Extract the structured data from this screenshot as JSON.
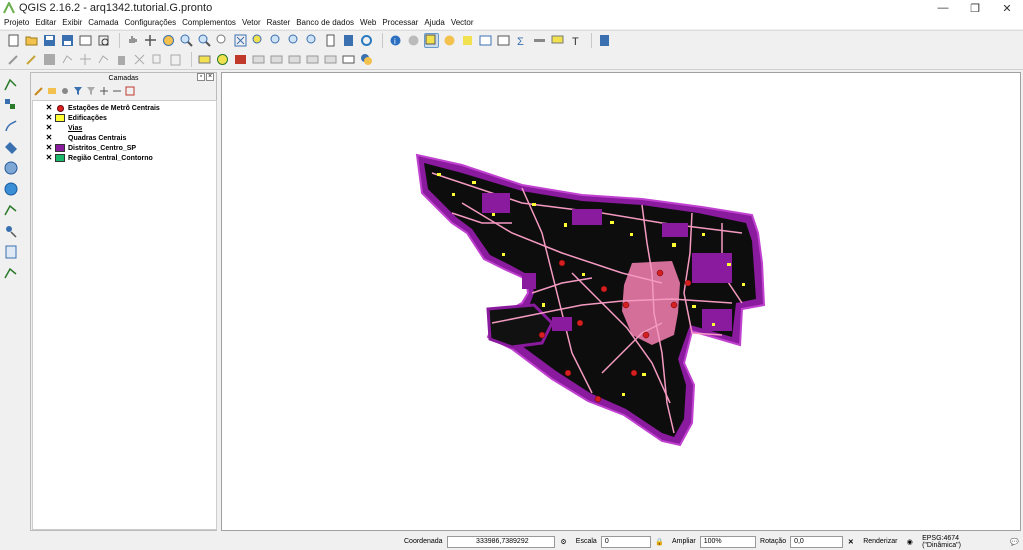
{
  "window": {
    "title": "QGIS 2.16.2 - arq1342.tutorial.G.pronto"
  },
  "menu": [
    "Projeto",
    "Editar",
    "Exibir",
    "Camada",
    "Configurações",
    "Complementos",
    "Vetor",
    "Raster",
    "Banco de dados",
    "Web",
    "Processar",
    "Ajuda",
    "Vector"
  ],
  "layers_panel": {
    "title": "Camadas",
    "layers": [
      {
        "label": "Estações de Metrô Centrais",
        "checked": "✕",
        "symbol": "point",
        "color": "#e02020"
      },
      {
        "label": "Edificações",
        "checked": "✕",
        "symbol": "fill",
        "color": "#ffff33"
      },
      {
        "label": "Vias",
        "checked": "✕",
        "symbol": "none",
        "color": "#000000"
      },
      {
        "label": "Quadras Centrais",
        "checked": "✕",
        "symbol": "none",
        "color": "#ffffff"
      },
      {
        "label": "Distritos_Centro_SP",
        "checked": "✕",
        "symbol": "fill",
        "color": "#8a1a9e"
      },
      {
        "label": "Região Central_Contorno",
        "checked": "✕",
        "symbol": "fill",
        "color": "#1ab86a"
      }
    ]
  },
  "statusbar": {
    "coord_label": "Coordenada",
    "coord_value": "333986,7389292",
    "scale_label": "Escala",
    "scale_value": "0",
    "zoom_label": "Ampliar",
    "zoom_value": "100%",
    "rotation_label": "Rotação",
    "rotation_value": "0,0",
    "render_label": "Renderizar",
    "crs_label": "EPSG:4674 (\"Dinâmica\")"
  },
  "colors": {
    "map_base": "#0d0d0d",
    "districts": "#8a1a9e",
    "roads": "#f49ac1",
    "buildings": "#ffff33",
    "stations": "#d42020"
  }
}
